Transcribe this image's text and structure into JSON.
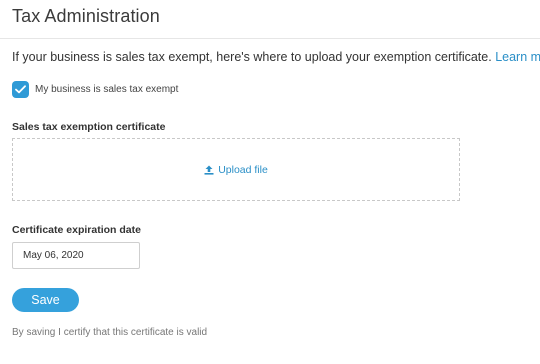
{
  "header": {
    "title": "Tax Administration"
  },
  "intro": {
    "text": "If your business is sales tax exempt, here's where to upload your exemption certificate. ",
    "link_label": "Learn more"
  },
  "exempt_checkbox": {
    "label": "My business is sales tax exempt",
    "checked": true
  },
  "certificate": {
    "label": "Sales tax exemption certificate",
    "upload_label": "Upload file",
    "upload_icon": "upload-icon"
  },
  "expiration": {
    "label": "Certificate expiration date",
    "value": "May 06, 2020"
  },
  "save_label": "Save",
  "note": "By saving I certify that this certificate is valid",
  "colors": {
    "accent": "#35a1dc",
    "link": "#2a8fc7",
    "checkbox": "#2f9ad6"
  }
}
